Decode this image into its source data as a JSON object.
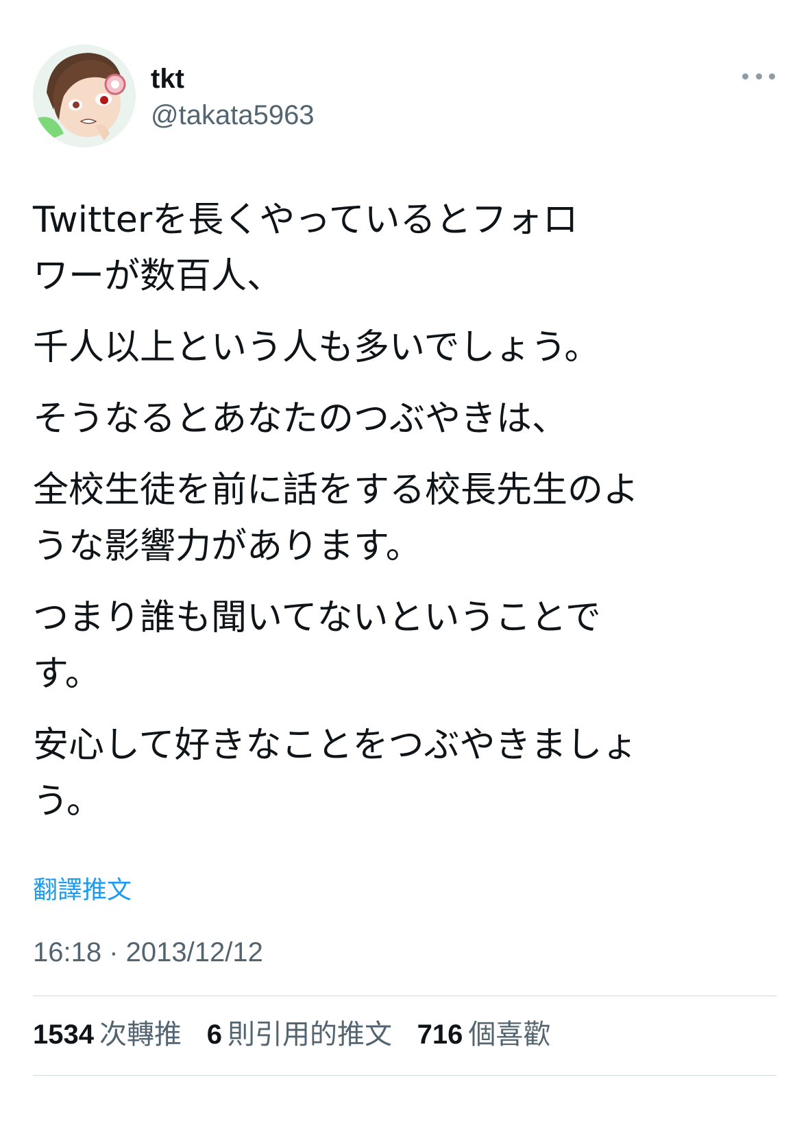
{
  "user": {
    "display_name": "tkt",
    "handle": "@takata5963",
    "avatar_icon": "anime-character-avatar"
  },
  "tweet": {
    "paragraphs": [
      [
        "Twitterを長くやっているとフォロ",
        "ワーが数百人、"
      ],
      [
        "千人以上という人も多いでしょう。"
      ],
      [
        "そうなるとあなたのつぶやきは、"
      ],
      [
        "全校生徒を前に話をする校長先生のよ",
        "うな影響力があります。"
      ],
      [
        "つまり誰も聞いてないということで",
        "す。"
      ],
      [
        "安心して好きなことをつぶやきましょ",
        "う。"
      ]
    ],
    "translate_label": "翻譯推文",
    "timestamp": "16:18 · 2013/12/12"
  },
  "stats": {
    "retweets": {
      "count": "1534",
      "label": "次轉推"
    },
    "quotes": {
      "count": "6",
      "label": "則引用的推文"
    },
    "likes": {
      "count": "716",
      "label": "個喜歡"
    }
  },
  "colors": {
    "text": "#0f1419",
    "secondary": "#536471",
    "link": "#1d9bf0",
    "divider": "#cfd9de"
  }
}
